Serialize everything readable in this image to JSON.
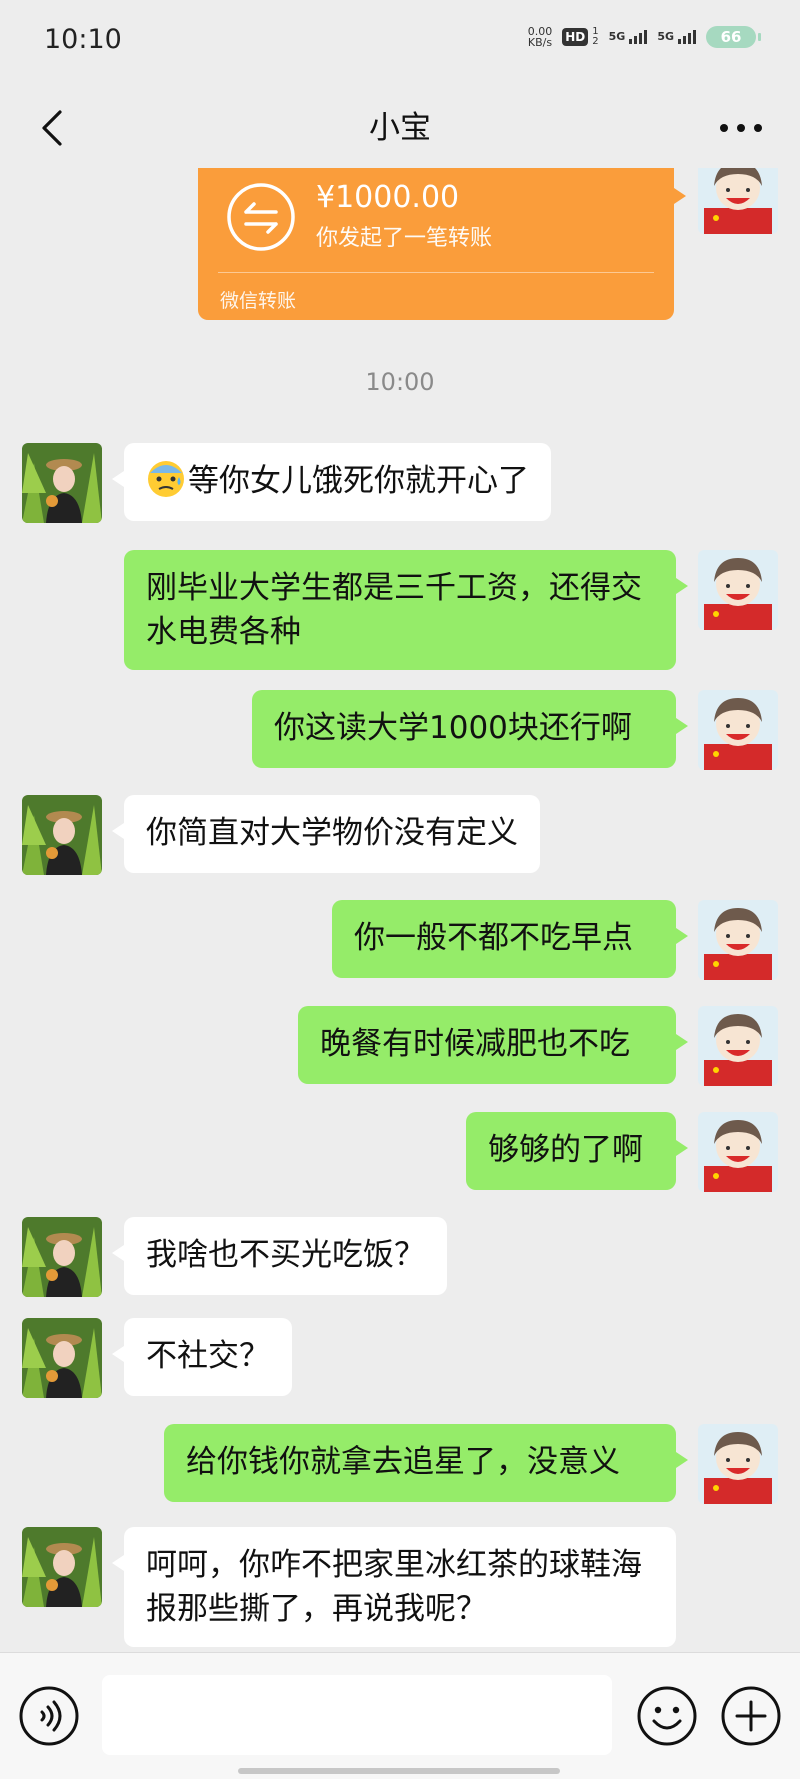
{
  "status": {
    "time": "10:10",
    "net_speed_value": "0.00",
    "net_speed_unit": "KB/s",
    "hd": "HD",
    "sim1_sup": "1",
    "sim1_sub": "2",
    "signal1": "5G",
    "signal2": "5G",
    "battery": "66"
  },
  "header": {
    "title": "小宝"
  },
  "transfer": {
    "amount": "¥1000.00",
    "description": "你发起了一笔转账",
    "footer": "微信转账",
    "color": "#fa9d3b"
  },
  "timestamp": "10:00",
  "messages": [
    {
      "from": "other",
      "emoji": "anxious-face-emoji",
      "text": "等你女儿饿死你就开心了"
    },
    {
      "from": "me",
      "text": "刚毕业大学生都是三千工资，还得交水电费各种"
    },
    {
      "from": "me",
      "text": "你这读大学1000块还行啊"
    },
    {
      "from": "other",
      "text": "你简直对大学物价没有定义"
    },
    {
      "from": "me",
      "text": "你一般不都不吃早点"
    },
    {
      "from": "me",
      "text": "晚餐有时候减肥也不吃"
    },
    {
      "from": "me",
      "text": "够够的了啊"
    },
    {
      "from": "other",
      "text": "我啥也不买光吃饭？"
    },
    {
      "from": "other",
      "text": "不社交？"
    },
    {
      "from": "me",
      "text": "给你钱你就拿去追星了，没意义"
    },
    {
      "from": "other",
      "text": "呵呵，你咋不把家里冰红茶的球鞋海报那些撕了，再说我呢？"
    }
  ],
  "colors": {
    "my_bubble": "#95ec69",
    "other_bubble": "#ffffff",
    "background": "#ededed"
  },
  "icons": {
    "back": "chevron-left-icon",
    "more": "more-dots-icon",
    "voice": "voice-icon",
    "emoji": "emoji-icon",
    "plus": "plus-icon"
  }
}
